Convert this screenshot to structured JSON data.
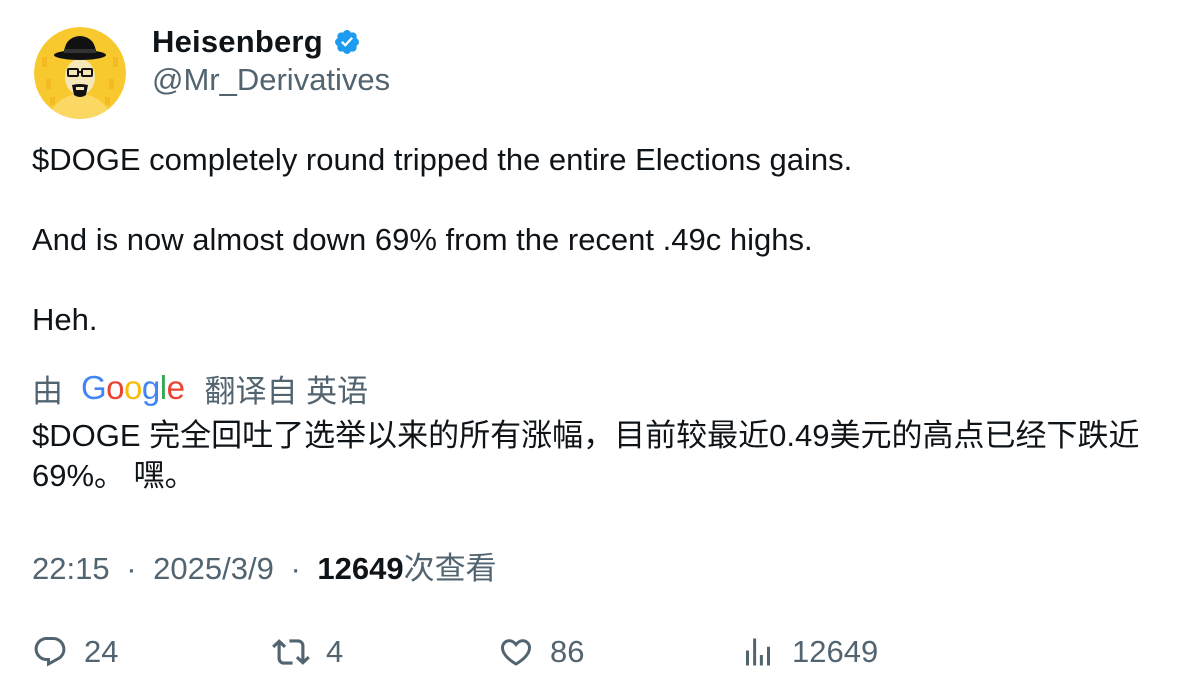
{
  "author": {
    "display_name": "Heisenberg",
    "handle": "@Mr_Derivatives",
    "verified": true,
    "avatar_icon": "heisenberg-avatar-icon",
    "verified_color": "#1d9bf0"
  },
  "tweet": {
    "paragraphs": [
      "$DOGE completely round tripped the entire Elections gains.",
      "And is now almost down 69% from the recent .49c highs.",
      "Heh."
    ]
  },
  "translation": {
    "prefix": "由",
    "provider": "Google",
    "suffix": "翻译自 英语",
    "text": "$DOGE 完全回吐了选举以来的所有涨幅，目前较最近0.49美元的高点已经下跌近69%。 嘿。"
  },
  "meta": {
    "time": "22:15",
    "separator": "·",
    "date": "2025/3/9",
    "views_count": "12649",
    "views_label": "次查看"
  },
  "actions": {
    "reply_count": "24",
    "retweet_count": "4",
    "like_count": "86",
    "views_count": "12649"
  },
  "colors": {
    "text_primary": "#0f1419",
    "text_secondary": "#536471",
    "google_blue": "#4285f4",
    "google_red": "#ea4335",
    "google_yellow": "#fbbc05",
    "google_green": "#34a853"
  }
}
